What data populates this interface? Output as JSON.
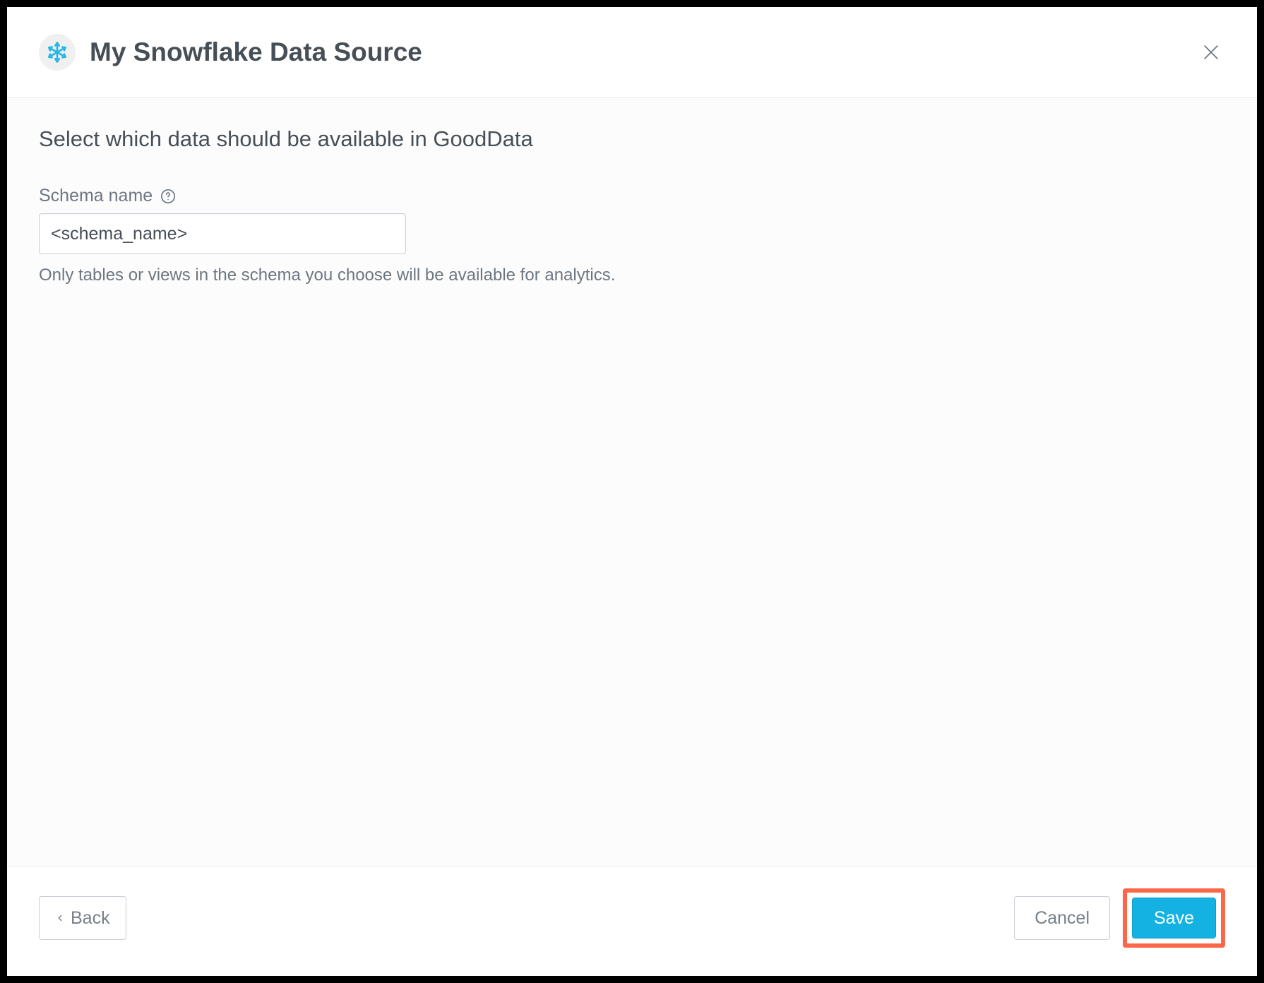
{
  "header": {
    "title": "My Snowflake Data Source"
  },
  "body": {
    "heading": "Select which data should be available in GoodData",
    "schema_field": {
      "label": "Schema name",
      "value": "<schema_name>",
      "hint": "Only tables or views in the schema you choose will be available for analytics."
    }
  },
  "footer": {
    "back_label": "Back",
    "cancel_label": "Cancel",
    "save_label": "Save"
  }
}
